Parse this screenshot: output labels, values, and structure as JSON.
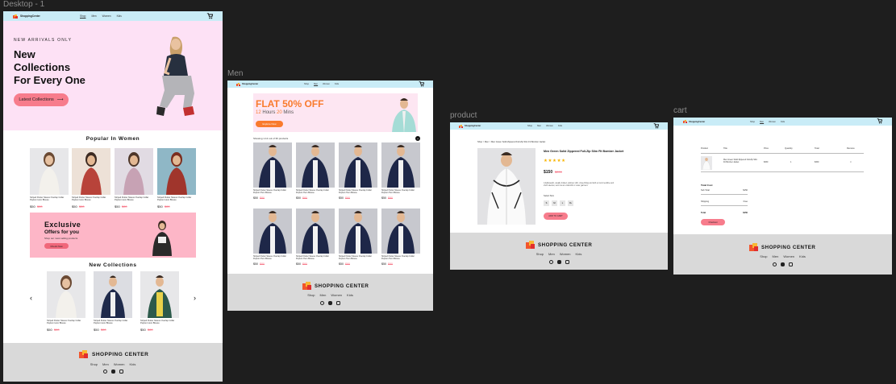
{
  "canvas": {
    "bg": "#1e1e1e"
  },
  "colors": {
    "nav": "#c9ecf7",
    "hero_pink": "#fde1f5",
    "accent_pink": "#f77c8c",
    "banner_pink": "#fdb6c7",
    "footer": "#d9d9d9",
    "sale_orange": "#f97b2d"
  },
  "brand": "ShoppingCenter",
  "nav_links": [
    "Shop",
    "Men",
    "Women",
    "Kids"
  ],
  "frames": {
    "desktop": {
      "label": "Desktop - 1",
      "hero": {
        "eyebrow": "NEW ARRIVALS ONLY",
        "title1": "New",
        "title2": "Collections",
        "title3": "For Every One",
        "button": "Latest Collections"
      },
      "popular": {
        "heading": "Popular In Women",
        "card_text": "Striped Flutter Sleeve Overlap Collar Peplum Hem Blouse",
        "price": "$50",
        "old_price": "$80"
      },
      "exclusive": {
        "title": "Exclusive",
        "subtitle": "Offers for you",
        "desc": "Shop our most selling products",
        "button": "Check Now"
      },
      "new_collections": {
        "heading": "New Collections",
        "price": "$50",
        "old_price": "$80",
        "card_text": "Striped Flutter Sleeve Overlap Collar Peplum Hem Blouse"
      },
      "footer": {
        "brand": "SHOPPING CENTER",
        "links": [
          "Shop",
          "Men",
          "Women",
          "Kids"
        ]
      }
    },
    "men": {
      "label": "Men",
      "banner": {
        "title": "FLAT 50% OFF",
        "hours_num": "12",
        "hours_label": "Hours",
        "mins_num": "20",
        "mins_label": "Mins",
        "button": "Explore Now"
      },
      "showing": "Showing 1-12 out of 36 products",
      "card_text": "Striped Flutter Sleeve Overlap Collar Peplum Hem Blouse",
      "price": "$50",
      "old_price": "$80",
      "footer": {
        "brand": "SHOPPING CENTER",
        "links": [
          "Shop",
          "Men",
          "Women",
          "Kids"
        ]
      }
    },
    "product": {
      "label": "product",
      "breadcrumb": "Shop > Men > Men Green Solid Zippered Full-Zip Slim Fit Bomber Jacket",
      "title": "Men Green Solid Zippered Full-Zip Slim Fit Bomber Jacket",
      "stars": "★★★★★",
      "price": "$150",
      "old_price": "$200",
      "desc": "A lightweight, usually knitted, pullover shirt, close-fitting and with a round neckline and short sleeves, worn as an undershirt or outer garment.",
      "size_label": "Select Size",
      "sizes": [
        "S",
        "M",
        "L",
        "XL"
      ],
      "button": "ADD TO CART",
      "footer": {
        "brand": "SHOPPING CENTER",
        "links": [
          "Shop",
          "Men",
          "Women",
          "Kids"
        ]
      }
    },
    "cart": {
      "label": "cart",
      "headers": [
        "Product",
        "Title",
        "Price",
        "Quantity",
        "Total",
        "Remove"
      ],
      "row": {
        "title": "Men Green Solid Zippered Full-Zip Slim Fit Bomber Jacket",
        "price": "$150",
        "qty": "1",
        "total": "$150",
        "remove": "×"
      },
      "totals": {
        "heading": "Total Cost",
        "sub_label": "Sub Total",
        "sub_value": "$150",
        "ship_label": "Shipping",
        "ship_value": "Free",
        "total_label": "Total",
        "total_value": "$150"
      },
      "button": "Checkout",
      "footer": {
        "brand": "SHOPPING CENTER",
        "links": [
          "Shop",
          "Men",
          "Women",
          "Kids"
        ]
      }
    }
  }
}
